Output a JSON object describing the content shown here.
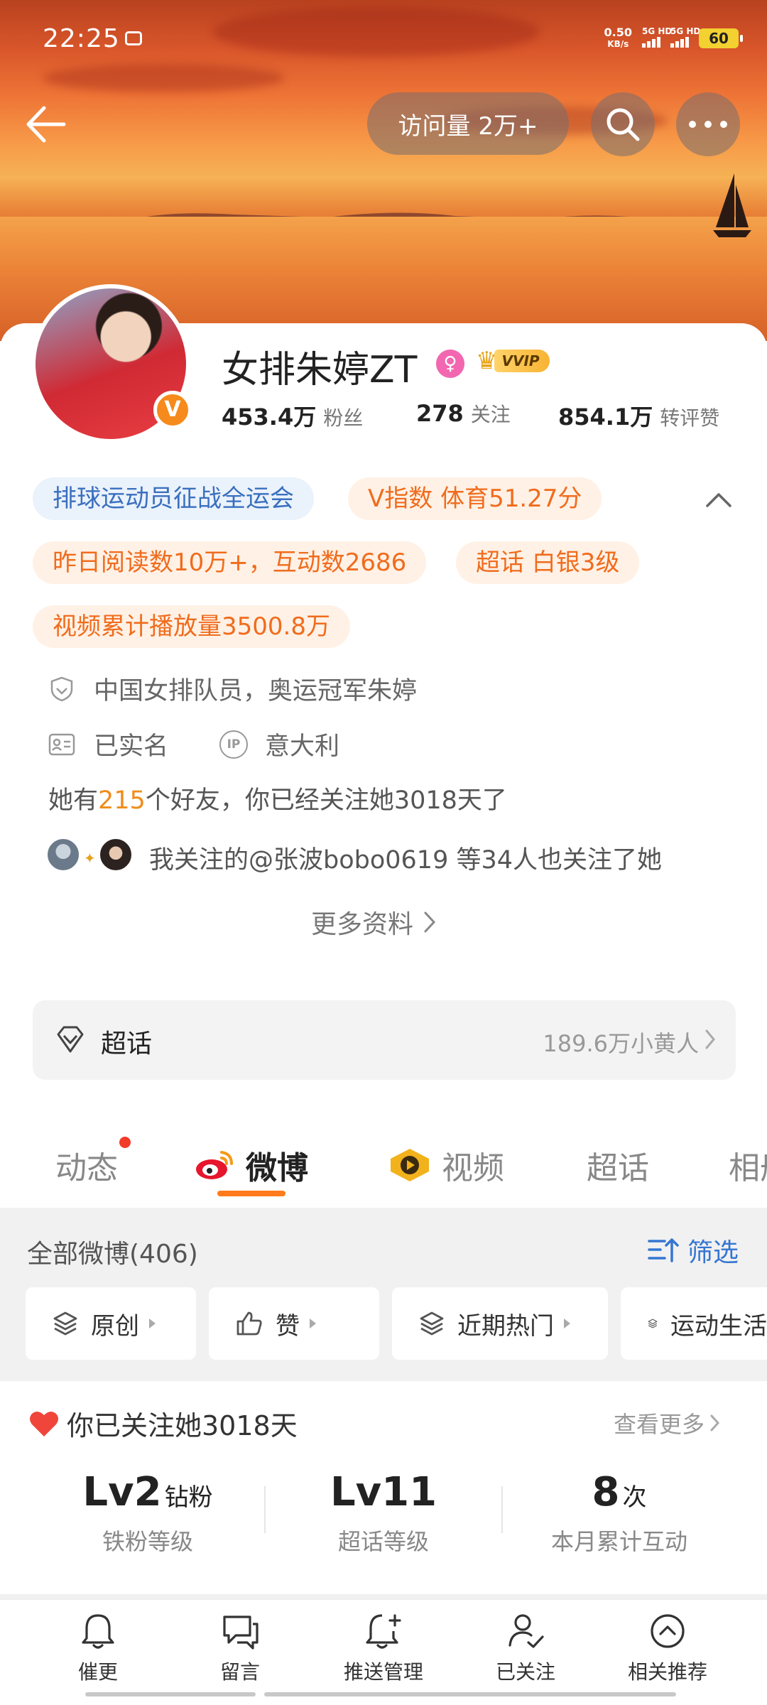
{
  "status_bar": {
    "time": "22:25",
    "net_speed_value": "0.50",
    "net_speed_unit": "KB/s",
    "sim1_label": "5G HD",
    "sim2_label": "5G HD",
    "battery": "60"
  },
  "header": {
    "visits": "访问量 2万+"
  },
  "profile": {
    "name": "女排朱婷ZT",
    "verified_badge": "V",
    "gender_symbol": "♀",
    "vip_label": "VVIP",
    "fans_value": "453.4万",
    "fans_label": "粉丝",
    "following_value": "278",
    "following_label": "关注",
    "likes_value": "854.1万",
    "likes_label": "转评赞"
  },
  "tags": [
    "排球运动员征战全运会",
    "V指数 体育51.27分",
    "昨日阅读数10万+，互动数2686",
    "超话 白银3级",
    "视频累计播放量3500.8万"
  ],
  "info": {
    "bio": "中国女排队员，奥运冠军朱婷",
    "realname": "已实名",
    "ip_badge": "IP",
    "ip_location": "意大利",
    "friends_prefix": "她有",
    "friends_count": "215",
    "friends_suffix": "个好友，你已经关注她3018天了",
    "mutual": "我关注的@张波bobo0619 等34人也关注了她",
    "more_info": "更多资料"
  },
  "chaohua": {
    "title": "超话",
    "count": "189.6万小黄人"
  },
  "tabs": {
    "dynamic": "动态",
    "weibo": "微博",
    "video": "视频",
    "chaohua": "超话",
    "related": "相册"
  },
  "feed": {
    "count_label": "全部微博(406)",
    "filter_label": "筛选",
    "chips": [
      "原创",
      "赞",
      "近期热门",
      "运动生活"
    ]
  },
  "follow_card": {
    "title": "你已关注她3018天",
    "see_more": "查看更多",
    "iron_value": "Lv2",
    "iron_unit": "钻粉",
    "iron_label": "铁粉等级",
    "chaohua_value": "Lv11",
    "chaohua_label": "超话等级",
    "interact_value": "8",
    "interact_unit": "次",
    "interact_label": "本月累计互动"
  },
  "bottom_bar": {
    "remind": "催更",
    "message": "留言",
    "push": "推送管理",
    "followed": "已关注",
    "recommend": "相关推荐"
  },
  "colors": {
    "accent_orange": "#ff7a1a",
    "link_blue": "#3576d2",
    "tag_blue_text": "#3a6fbf",
    "tag_orange_text": "#f06c1d",
    "friends_highlight": "#f08c1c"
  }
}
